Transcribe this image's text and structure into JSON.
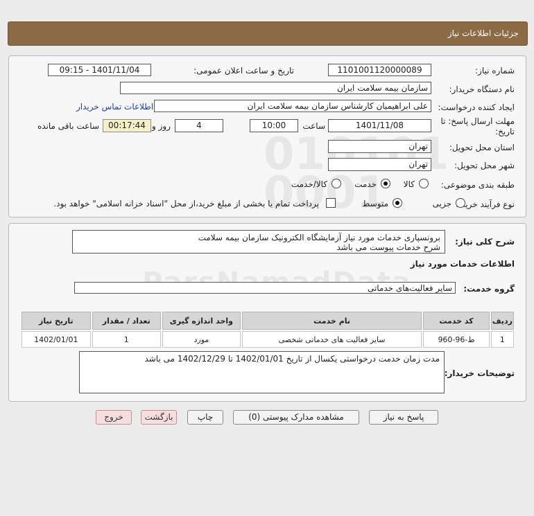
{
  "header": {
    "title": "جزئیات اطلاعات نیاز"
  },
  "form": {
    "need_number_label": "شماره نیاز:",
    "need_number": "1101001120000089",
    "announce_label": "تاریخ و ساعت اعلان عمومی:",
    "announce_value": "1401/11/04 - 09:15",
    "buyer_org_label": "نام دستگاه خریدار:",
    "buyer_org": "سازمان بیمه سلامت ایران",
    "creator_label": "ایجاد کننده درخواست:",
    "creator": "علی ابراهیمیان کارشناس سازمان بیمه سلامت ایران",
    "contact_link": "اطلاعات تماس خریدار",
    "deadline_label_1": "مهلت ارسال پاسخ: تا",
    "deadline_label_2": "تاریخ:",
    "deadline_date": "1401/11/08",
    "time_label": "ساعت",
    "deadline_time": "10:00",
    "days_value": "4",
    "days_label": "روز و",
    "remaining_time": "00:17:44",
    "remaining_label": "ساعت باقی مانده",
    "province_label": "استان محل تحویل:",
    "province": "تهران",
    "city_label": "شهر محل تحویل:",
    "city": "تهران",
    "category_label": "طبقه بندی موضوعی:",
    "category_options": [
      "کالا",
      "خدمت",
      "کالا/خدمت"
    ],
    "category_selected": "خدمت",
    "process_label": "نوع فرآیند خرید :",
    "process_options": [
      "جزیی",
      "متوسط"
    ],
    "process_selected": "متوسط",
    "payment_note": "پرداخت تمام یا بخشی از مبلغ خرید،از محل \"اسناد خزانه اسلامی\" خواهد بود."
  },
  "summary": {
    "label": "شرح کلی نیاز:",
    "line1": "برونسپاری خدمات مورد نیاز آزمایشگاه الکترونیک سازمان بیمه سلامت",
    "line2": "شرح خدمات پیوست می باشد"
  },
  "services": {
    "section_title": "اطلاعات خدمات مورد نیاز",
    "group_label": "گروه خدمت:",
    "group_value": "سایر فعالیت‌های خدماتی",
    "columns": [
      "ردیف",
      "کد خدمت",
      "نام خدمت",
      "واحد اندازه گیری",
      "تعداد / مقدار",
      "تاریخ نیاز"
    ],
    "rows": [
      [
        "1",
        "ط-96-960",
        "سایر فعالیت های خدماتی شخصی",
        "مورد",
        "1",
        "1402/01/01"
      ]
    ]
  },
  "buyer_notes": {
    "label": "توضیحات خریدار:",
    "text": "مدت زمان خدمت درخواستی یکسال از تاریخ 1402/01/01 تا 1402/12/29 می باشد"
  },
  "buttons": {
    "reply": "پاسخ به نیاز",
    "attachments": "مشاهده مدارک پیوستی (0)",
    "print": "چاپ",
    "back": "بازگشت",
    "exit": "خروج"
  }
}
